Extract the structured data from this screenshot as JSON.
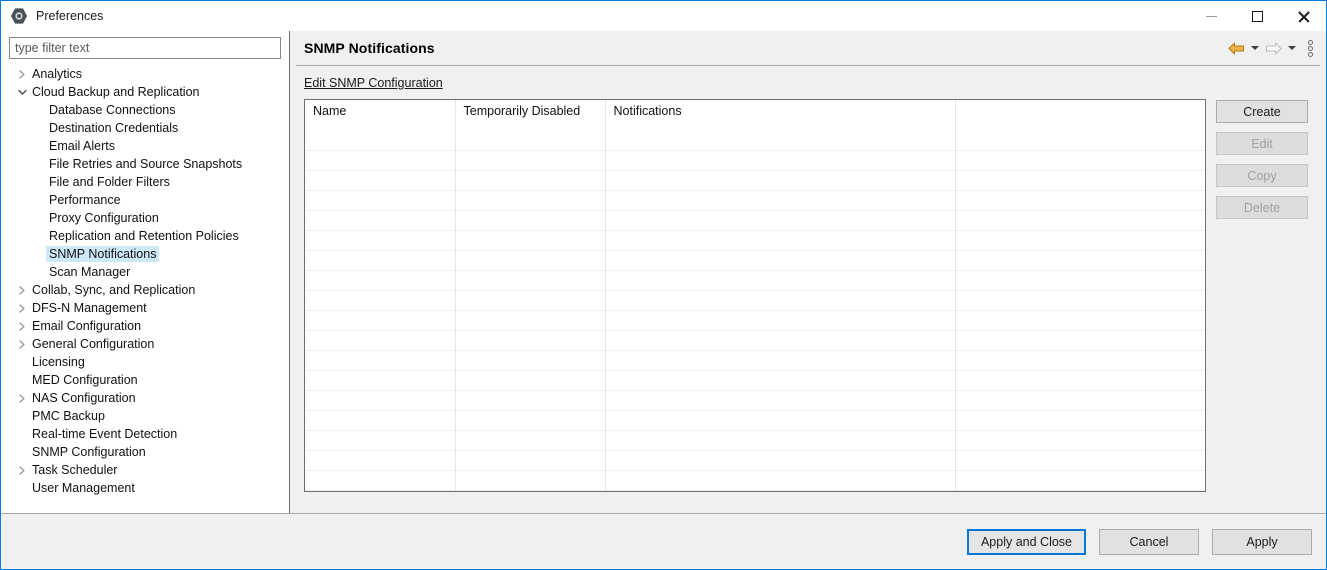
{
  "window": {
    "title": "Preferences",
    "app_icon": "gear-hexagon-icon",
    "minimize_label": "Minimize",
    "maximize_label": "Maximize",
    "close_label": "Close"
  },
  "sidebar": {
    "filter": {
      "value": "",
      "placeholder": "type filter text"
    },
    "items": [
      {
        "label": "Analytics",
        "level": 1,
        "expander": "collapsed",
        "selected": false
      },
      {
        "label": "Cloud Backup and Replication",
        "level": 1,
        "expander": "expanded",
        "selected": false
      },
      {
        "label": "Database Connections",
        "level": 2,
        "expander": "none",
        "selected": false
      },
      {
        "label": "Destination Credentials",
        "level": 2,
        "expander": "none",
        "selected": false
      },
      {
        "label": "Email Alerts",
        "level": 2,
        "expander": "none",
        "selected": false
      },
      {
        "label": "File Retries and Source Snapshots",
        "level": 2,
        "expander": "none",
        "selected": false
      },
      {
        "label": "File and Folder Filters",
        "level": 2,
        "expander": "none",
        "selected": false
      },
      {
        "label": "Performance",
        "level": 2,
        "expander": "none",
        "selected": false
      },
      {
        "label": "Proxy Configuration",
        "level": 2,
        "expander": "none",
        "selected": false
      },
      {
        "label": "Replication and Retention Policies",
        "level": 2,
        "expander": "none",
        "selected": false
      },
      {
        "label": "SNMP Notifications",
        "level": 2,
        "expander": "none",
        "selected": true
      },
      {
        "label": "Scan Manager",
        "level": 2,
        "expander": "none",
        "selected": false
      },
      {
        "label": "Collab, Sync, and Replication",
        "level": 1,
        "expander": "collapsed",
        "selected": false
      },
      {
        "label": "DFS-N Management",
        "level": 1,
        "expander": "collapsed",
        "selected": false
      },
      {
        "label": "Email Configuration",
        "level": 1,
        "expander": "collapsed",
        "selected": false
      },
      {
        "label": "General Configuration",
        "level": 1,
        "expander": "collapsed",
        "selected": false
      },
      {
        "label": "Licensing",
        "level": 1,
        "expander": "none",
        "selected": false
      },
      {
        "label": "MED Configuration",
        "level": 1,
        "expander": "none",
        "selected": false
      },
      {
        "label": "NAS Configuration",
        "level": 1,
        "expander": "collapsed",
        "selected": false
      },
      {
        "label": "PMC Backup",
        "level": 1,
        "expander": "none",
        "selected": false
      },
      {
        "label": "Real-time Event Detection",
        "level": 1,
        "expander": "none",
        "selected": false
      },
      {
        "label": "SNMP Configuration",
        "level": 1,
        "expander": "none",
        "selected": false
      },
      {
        "label": "Task Scheduler",
        "level": 1,
        "expander": "collapsed",
        "selected": false
      },
      {
        "label": "User Management",
        "level": 1,
        "expander": "none",
        "selected": false
      }
    ]
  },
  "panel": {
    "title": "SNMP Notifications",
    "nav": {
      "back_icon": "back-arrow-icon",
      "back_dropdown_icon": "chevron-down-icon",
      "forward_icon": "forward-arrow-icon",
      "forward_dropdown_icon": "chevron-down-icon",
      "view_menu_icon": "view-menu-icon",
      "back_color": "#e8a33d",
      "forward_color": "#b4b4b4"
    },
    "edit_link": "Edit SNMP Configuration",
    "table": {
      "columns": [
        "Name",
        "Temporarily Disabled",
        "Notifications",
        ""
      ],
      "rows": [],
      "empty_row_count": 20
    },
    "buttons": [
      {
        "label": "Create",
        "enabled": true
      },
      {
        "label": "Edit",
        "enabled": false
      },
      {
        "label": "Copy",
        "enabled": false
      },
      {
        "label": "Delete",
        "enabled": false
      }
    ]
  },
  "footer": {
    "buttons": [
      {
        "label": "Apply and Close",
        "default": true
      },
      {
        "label": "Cancel",
        "default": false
      },
      {
        "label": "Apply",
        "default": false
      }
    ]
  }
}
